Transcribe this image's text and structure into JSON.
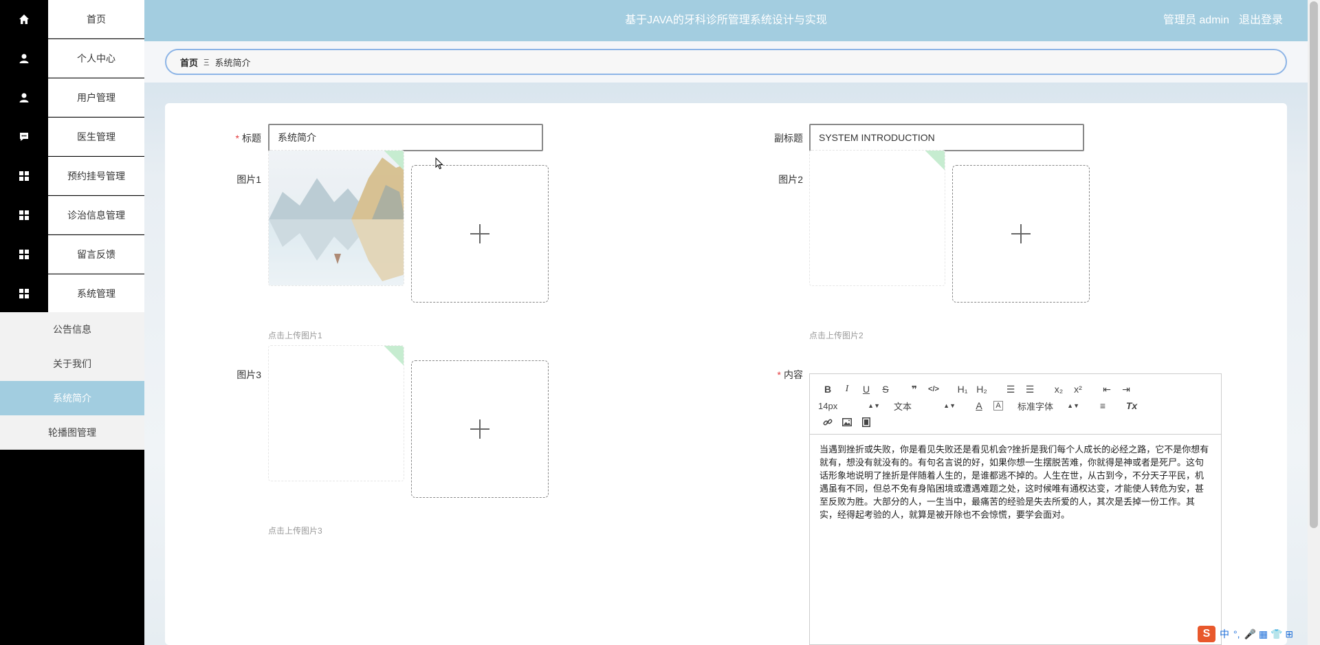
{
  "sidebar": {
    "items": [
      {
        "label": "首页",
        "icon": "home-icon"
      },
      {
        "label": "个人中心",
        "icon": "user-icon"
      },
      {
        "label": "用户管理",
        "icon": "user-icon"
      },
      {
        "label": "医生管理",
        "icon": "chat-icon"
      },
      {
        "label": "预约挂号管理",
        "icon": "grid-icon"
      },
      {
        "label": "诊治信息管理",
        "icon": "grid-icon"
      },
      {
        "label": "留言反馈",
        "icon": "grid-icon"
      },
      {
        "label": "系统管理",
        "icon": "grid-icon"
      }
    ],
    "sub_items": [
      {
        "label": "公告信息"
      },
      {
        "label": "关于我们"
      },
      {
        "label": "系统简介"
      },
      {
        "label": "轮播图管理"
      }
    ],
    "active_sub": "系统简介"
  },
  "header": {
    "title": "基于JAVA的牙科诊所管理系统设计与实现",
    "user_label": "管理员 admin",
    "logout": "退出登录"
  },
  "breadcrumb": {
    "home": "首页",
    "separator": "Ξ",
    "current": "系统简介"
  },
  "form": {
    "title_label": "标题",
    "title_value": "系统简介",
    "subtitle_label": "副标题",
    "subtitle_value": "SYSTEM INTRODUCTION",
    "pic1_label": "图片1",
    "pic1_tip": "点击上传图片1",
    "pic2_label": "图片2",
    "pic2_tip": "点击上传图片2",
    "pic3_label": "图片3",
    "pic3_tip": "点击上传图片3",
    "content_label": "内容",
    "required_mark": "*"
  },
  "editor": {
    "toolbar": {
      "bold": "B",
      "italic": "I",
      "underline": "U",
      "strike": "S",
      "quote": "❞",
      "code": "</>",
      "h1": "H₁",
      "h2": "H₂",
      "ordered_list": "☰",
      "bullet_list": "☰",
      "subscript": "x₂",
      "superscript": "x²",
      "outdent": "⇤",
      "indent": "⇥",
      "font_size": "14px",
      "text_type": "文本",
      "color": "A",
      "bg_color": "A",
      "font_family": "标准字体",
      "align": "≡",
      "clean": "Tx"
    },
    "content": "当遇到挫折或失败，你是看见失败还是看见机会?挫折是我们每个人成长的必经之路，它不是你想有就有，想没有就没有的。有句名言说的好，如果你想一生摆脱苦难，你就得是神或者是死尸。这句话形象地说明了挫折是伴随着人生的，是谁都逃不掉的。人生在世，从古到今，不分天子平民，机遇虽有不同，但总不免有身陷困境或遭遇难题之处，这时候唯有通权达变，才能使人转危为安，甚至反败为胜。大部分的人，一生当中，最痛苦的经验是失去所爱的人，其次是丢掉一份工作。其实，经得起考验的人，就算是被开除也不会惊慌，要学会面对。"
  },
  "ime": {
    "logo": "S",
    "lang": "中",
    "punct": "°,",
    "items": "🎤 ▦ 👕 ⊞"
  },
  "colors": {
    "header_bg": "#a3cde0",
    "active_sub_bg": "#a2cde0",
    "breadcrumb_border": "#8cb4e6",
    "required": "#e4393c"
  }
}
